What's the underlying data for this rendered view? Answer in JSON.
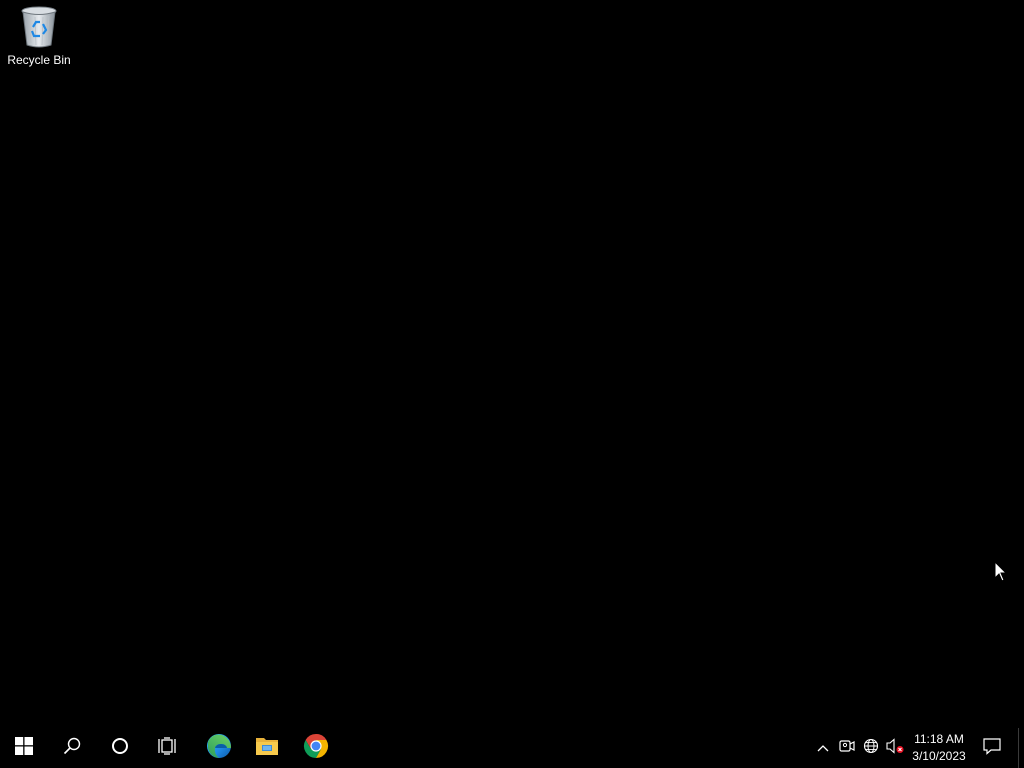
{
  "desktop": {
    "icons": [
      {
        "label": "Recycle Bin",
        "icon": "recycle-bin-icon"
      }
    ]
  },
  "taskbar": {
    "start": {
      "icon": "windows-logo-icon"
    },
    "search": {
      "icon": "search-icon"
    },
    "cortana": {
      "icon": "cortana-circle-icon"
    },
    "task_view": {
      "icon": "task-view-icon"
    },
    "pinned": [
      {
        "icon": "edge-icon"
      },
      {
        "icon": "file-explorer-icon"
      },
      {
        "icon": "chrome-icon"
      }
    ],
    "tray": {
      "chevron": "chevron-up-icon",
      "meet": "meet-now-icon",
      "network": "network-globe-icon",
      "volume": "volume-muted-icon"
    },
    "clock": {
      "time": "11:18 AM",
      "date": "3/10/2023"
    },
    "notifications": {
      "icon": "action-center-icon"
    }
  },
  "colors": {
    "wallpaper": "#000000",
    "taskbar": "#000000",
    "icon_fg": "#ffffff",
    "accent_blue": "#0a84d6"
  }
}
